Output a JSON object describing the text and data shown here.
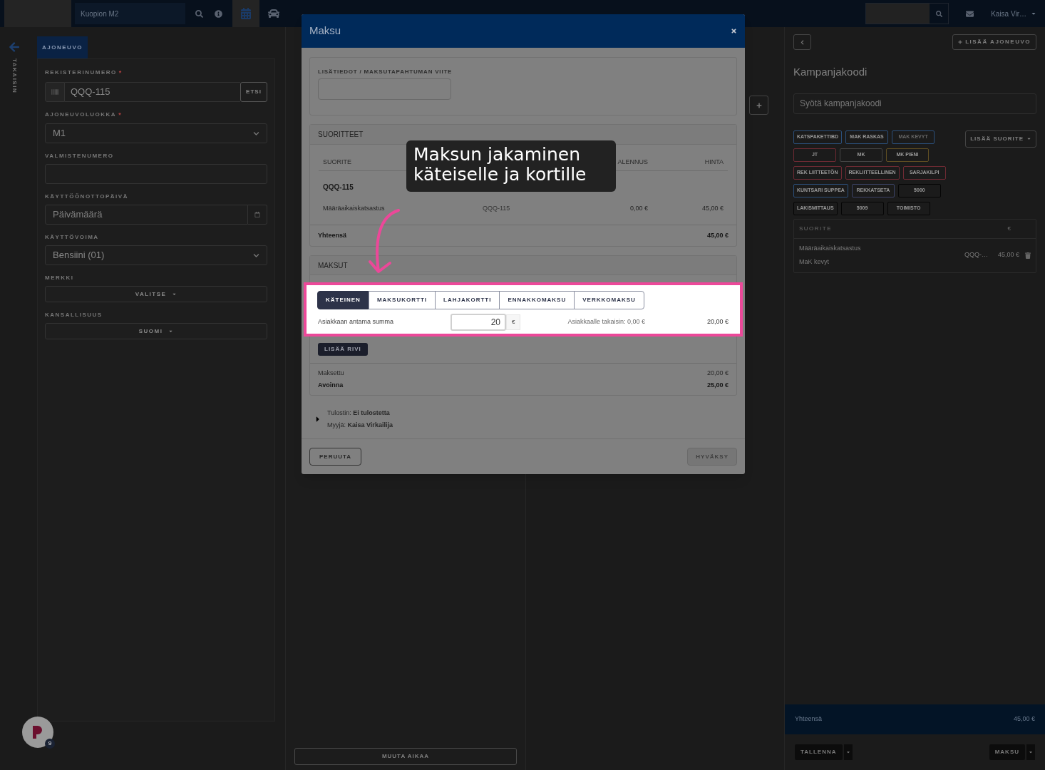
{
  "top_bar": {
    "location": "Kuopion M2",
    "user": "Kaisa Vir…"
  },
  "sidebar": {
    "back_label": "TAKAISIN"
  },
  "vehicle_panel": {
    "tab": "AJONEUVO",
    "fields": [
      {
        "kind": "search",
        "label": "REKISTERINUMERO",
        "required_mark": "*",
        "value": "QQQ-115",
        "button": "ETSI"
      },
      {
        "kind": "select",
        "label": "AJONEUVOLUOKKA",
        "required_mark": "*",
        "value": "M1"
      },
      {
        "kind": "text",
        "label": "VALMISTENUMERO"
      },
      {
        "kind": "date",
        "label": "KÄYTTÖÖNOTTOPÄIVÄ",
        "placeholder": "Päivämäärä"
      },
      {
        "kind": "select",
        "label": "KÄYTTÖVOIMA",
        "value": "Bensiini (01)"
      },
      {
        "kind": "dropdown",
        "label": "MERKKI",
        "value": "VALITSE"
      },
      {
        "kind": "dropdown",
        "label": "KANSALLISUUS",
        "value": "SUOMI"
      }
    ]
  },
  "schedule_panel": {
    "button": "MUUTA AIKAA"
  },
  "right_panel": {
    "add_vehicle": "LISÄÄ AJONEUVO",
    "campaign_title": "Kampanjakoodi",
    "campaign_placeholder": "Syötä kampanjakoodi",
    "add_service": "LISÄÄ SUORITE",
    "tag_rows": [
      [
        {
          "label": "KATSPAKETTIBD",
          "color": "#2b4f7a",
          "disabled": false
        },
        {
          "label": "MAK RASKAS",
          "color": "#2b4f7a",
          "disabled": false
        },
        {
          "label": "MAK KEVYT",
          "color": "#2b4f7a",
          "disabled": true
        }
      ],
      [
        {
          "label": "JT",
          "color": "#6e2a33",
          "disabled": false
        },
        {
          "label": "MK",
          "color": "#444444",
          "disabled": false
        },
        {
          "label": "MK PIENI",
          "color": "#5e4d22",
          "disabled": false
        }
      ],
      [
        {
          "label": "REK LIITTEETÖN",
          "color": "#6e2a33",
          "disabled": false
        },
        {
          "label": "REKLIITTEELLINEN",
          "color": "#6e2a33",
          "disabled": false
        },
        {
          "label": "SARJAKILPI",
          "color": "#6e2a33",
          "disabled": false
        }
      ],
      [
        {
          "label": "KUNTSARI SUPPEA",
          "color": "#2b4f7a",
          "disabled": false
        },
        {
          "label": "REKKATSETA",
          "color": "#3b4366",
          "disabled": false
        },
        {
          "label": "5000",
          "color": "#050505",
          "disabled": false
        }
      ],
      [
        {
          "label": "LAKISMITTAUS",
          "color": "#050505",
          "disabled": false
        },
        {
          "label": "5009",
          "color": "#050505",
          "disabled": false
        },
        {
          "label": "TOIMISTO",
          "color": "#050505",
          "disabled": false
        }
      ]
    ],
    "table": {
      "columns": [
        "SUORITE",
        "€"
      ],
      "rows": [
        {
          "name": "Määräaikaiskatsastus",
          "detail": "MaK kevyt",
          "vehicle": "QQQ-…",
          "price": "45,00 €"
        }
      ]
    },
    "total_label": "Yhteensä",
    "total": "45,00 €",
    "save": "TALLENNA",
    "pay": "MAKSU"
  },
  "dialog": {
    "title": "Maksu",
    "reference_label": "LISÄTIEDOT / MAKSUTAPAHTUMAN VIITE",
    "services": {
      "title": "SUORITTEET",
      "columns": [
        "SUORITE",
        "ALENNUS",
        "HINTA"
      ],
      "group": "QQQ-115",
      "rows": [
        {
          "name": "Määräaikaiskatsastus",
          "vehicle": "QQQ-115",
          "discount": "0,00 €",
          "price": "45,00 €"
        }
      ],
      "total_label": "Yhteensä",
      "total": "45,00 €"
    },
    "payments": {
      "title": "MAKSUT",
      "methods": [
        {
          "label": "KÄTEINEN",
          "selected": true
        },
        {
          "label": "MAKSUKORTTI",
          "selected": false
        },
        {
          "label": "LAHJAKORTTI",
          "selected": false
        },
        {
          "label": "ENNAKKOMAKSU",
          "selected": false
        },
        {
          "label": "VERKKOMAKSU",
          "selected": false
        }
      ],
      "amount_label": "Asiakkaan antama summa",
      "amount": "20",
      "currency": "€",
      "change": "Asiakkaalle takaisin: 0,00 €",
      "line_total": "20,00 €",
      "add_row": "LISÄÄ RIVI",
      "paid_label": "Maksettu",
      "paid": "20,00 €",
      "open_label": "Avoinna",
      "open": "25,00 €"
    },
    "details": {
      "expanded": false,
      "printer": "Tulostin: **Ei tulostetta**",
      "seller": "Myyjä: **Kaisa Virkailija**"
    },
    "cancel": "PERUUTA",
    "accept": "HYVÄKSY",
    "accept_disabled": true
  },
  "tooltip": "Maksun jakaminen käteiselle ja kortille",
  "notifications": {
    "count": "9"
  }
}
